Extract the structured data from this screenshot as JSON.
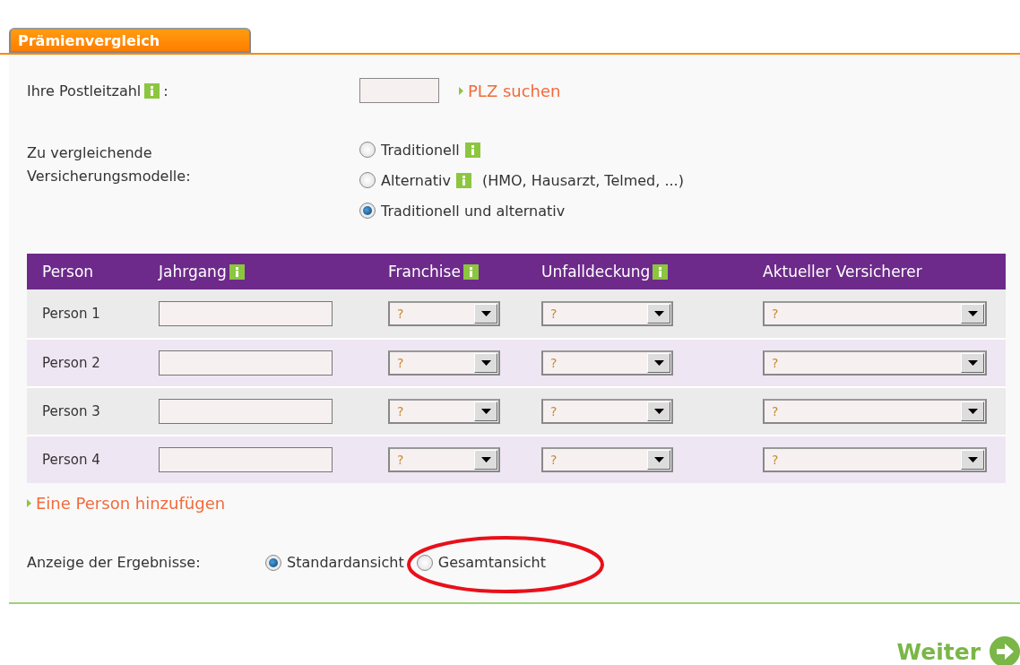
{
  "tab": {
    "label": "Prämienvergleich",
    "selected": true
  },
  "postcode": {
    "label": "Ihre Postleitzahl",
    "info": true,
    "colon": ":",
    "link": "PLZ suchen"
  },
  "models": {
    "label": "Zu vergleichende Versicherungsmodelle:",
    "options": [
      {
        "label": "Traditionell",
        "info": true,
        "selected": false
      },
      {
        "label": "Alternativ",
        "info": true,
        "note": "(HMO, Hausarzt, Telmed, ...)",
        "selected": false
      },
      {
        "label": "Traditionell und alternativ",
        "info": false,
        "selected": true
      }
    ]
  },
  "table": {
    "columns": [
      {
        "label": "Person",
        "info": false
      },
      {
        "label": "Jahrgang",
        "info": true
      },
      {
        "label": "Franchise",
        "info": true
      },
      {
        "label": "Unfalldeckung",
        "info": true
      },
      {
        "label": "Aktueller Versicherer",
        "info": false
      }
    ],
    "rows": [
      {
        "person": "Person 1",
        "franchise": "?",
        "accident": "?",
        "insurer": "?"
      },
      {
        "person": "Person 2",
        "franchise": "?",
        "accident": "?",
        "insurer": "?"
      },
      {
        "person": "Person 3",
        "franchise": "?",
        "accident": "?",
        "insurer": "?"
      },
      {
        "person": "Person 4",
        "franchise": "?",
        "accident": "?",
        "insurer": "?"
      }
    ]
  },
  "add_link": "Eine Person hinzufügen",
  "results": {
    "label": "Anzeige der Ergebnisse:",
    "options": [
      {
        "label": "Standardansicht",
        "selected": true
      },
      {
        "label": "Gesamtansicht",
        "selected": false,
        "circled": true
      }
    ]
  },
  "next_button": "Weiter"
}
